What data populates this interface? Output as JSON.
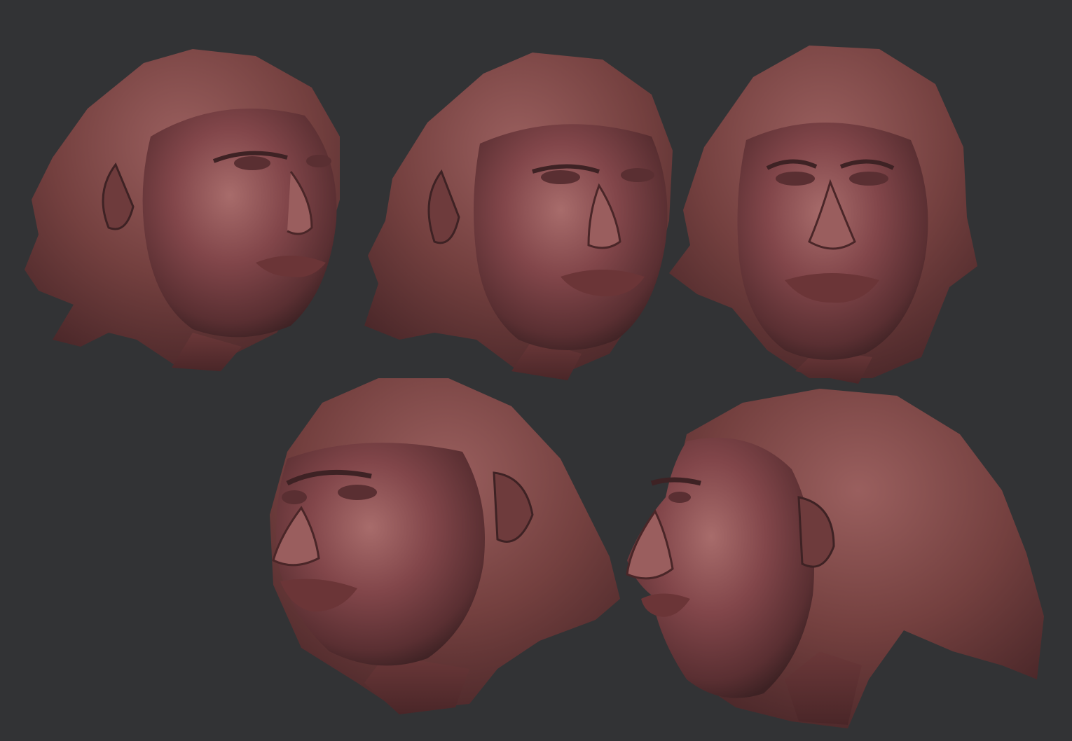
{
  "scene": {
    "background_color": "#323335",
    "material_color": "#7a3f40",
    "highlight_color": "#a66a6a",
    "shadow_color": "#3c1f20",
    "renders": [
      {
        "view": "three-quarter-right"
      },
      {
        "view": "slight-right"
      },
      {
        "view": "front"
      },
      {
        "view": "three-quarter-left"
      },
      {
        "view": "profile-left"
      }
    ]
  }
}
